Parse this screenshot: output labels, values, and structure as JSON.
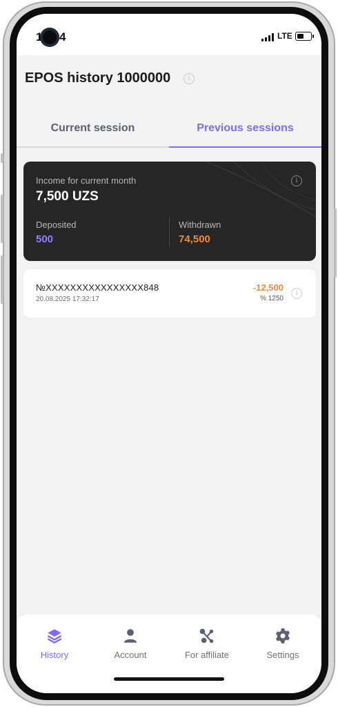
{
  "status_bar": {
    "time": "10:44",
    "network": "LTE"
  },
  "header": {
    "title": "EPOS history 1000000",
    "info_icon": "info-icon"
  },
  "tabs": [
    {
      "label": "Current session",
      "active": false
    },
    {
      "label": "Previous sessions",
      "active": true
    }
  ],
  "summary": {
    "income_label": "Income for current month",
    "income_value": "7,500 UZS",
    "deposited_label": "Deposited",
    "deposited_value": "500",
    "withdrawn_label": "Withdrawn",
    "withdrawn_value": "74,500"
  },
  "transactions": [
    {
      "card": "№XXXXXXXXXXXXXXXX848",
      "date": "20.08.2025 17:32:17",
      "amount": "-12,500",
      "fee": "% 1250"
    }
  ],
  "nav": [
    {
      "label": "History",
      "icon": "layers-icon",
      "active": true
    },
    {
      "label": "Account",
      "icon": "user-icon",
      "active": false
    },
    {
      "label": "For affiliate",
      "icon": "network-icon",
      "active": false
    },
    {
      "label": "Settings",
      "icon": "gear-icon",
      "active": false
    }
  ],
  "colors": {
    "accent": "#7b6ef6",
    "orange": "#f08a3c",
    "card_dark": "#262626"
  }
}
